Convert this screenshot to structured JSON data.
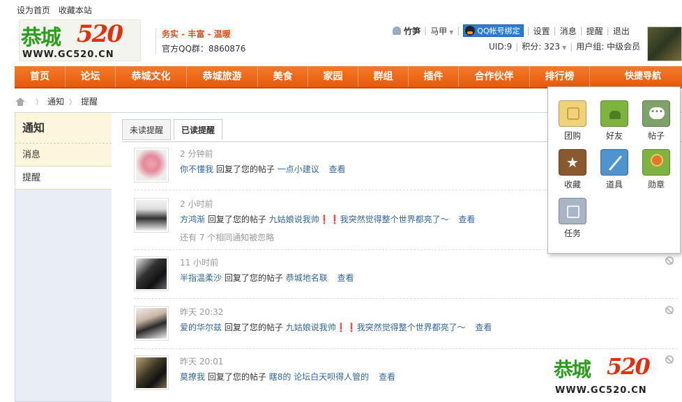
{
  "top_links": [
    "设为首页",
    "收藏本站"
  ],
  "logo": {
    "name": "恭城",
    "number": "520",
    "url": "WWW.GC520.CN"
  },
  "slogan": {
    "line1": "务实 - 丰富 - 温暖",
    "qq_group": "官方QQ群：8860876"
  },
  "user": {
    "username": "竹笋",
    "subuser": "马甲",
    "qq_bind": "QQ帐号绑定",
    "links": [
      "设置",
      "消息",
      "提醒",
      "退出"
    ],
    "uid": "UID:9",
    "credits": "积分: 323",
    "group": "用户组: 中级会员"
  },
  "nav": {
    "items": [
      "首页",
      "论坛",
      "恭城文化",
      "恭城旅游",
      "美食",
      "家园",
      "群组",
      "插件",
      "合作伙伴",
      "排行榜"
    ],
    "quick": "快捷导航"
  },
  "breadcrumb": [
    "通知",
    "提醒"
  ],
  "sidebar": {
    "title": "通知",
    "items": [
      "消息",
      "提醒"
    ]
  },
  "tabs": [
    "未读提醒",
    "已读提醒"
  ],
  "notices": [
    {
      "time": "2 分钟前",
      "user": "你不懂我",
      "action": "回复了您的帖子",
      "thread": "一点小建议",
      "view": "查看",
      "extra": ""
    },
    {
      "time": "2 小时前",
      "user": "方鸿渐",
      "action": "回复了您的帖子",
      "thread": "九姑娘说我帅❗❗我突然觉得整个世界都亮了～",
      "view": "查看",
      "extra": "还有 7 个相同通知被忽略"
    },
    {
      "time": "11 小时前",
      "user": "半指温柔沙",
      "action": "回复了您的帖子",
      "thread": "恭城地名联",
      "view": "查看",
      "extra": ""
    },
    {
      "time": "昨天 20:32",
      "user": "爱的华尔兹",
      "action": "回复了您的帖子",
      "thread": "九姑娘说我帅❗❗我突然觉得整个世界都亮了～",
      "view": "查看",
      "extra": ""
    },
    {
      "time": "昨天 20:01",
      "user": "莫撩我",
      "action": "回复了您的帖子",
      "thread": "瞎8的 论坛白天呗得人管的",
      "view": "查看",
      "extra": ""
    }
  ],
  "quick_nav": [
    {
      "label": "团购",
      "icon": "group-buy-icon",
      "color": "#f0d27a"
    },
    {
      "label": "好友",
      "icon": "friends-icon",
      "color": "#7fb33f"
    },
    {
      "label": "帖子",
      "icon": "posts-icon",
      "color": "#7ea26a"
    },
    {
      "label": "收藏",
      "icon": "favorite-star-icon",
      "color": "#8a5a2e"
    },
    {
      "label": "道具",
      "icon": "magic-wand-icon",
      "color": "#4f94cc"
    },
    {
      "label": "勋章",
      "icon": "medal-icon",
      "color": "#7fb33f"
    },
    {
      "label": "任务",
      "icon": "task-icon",
      "color": "#a9b4c4"
    }
  ],
  "colors": {
    "nav_orange": "#e55a0c",
    "link_blue": "#336699",
    "logo_green": "#2c9b1e",
    "logo_red": "#e03010"
  }
}
